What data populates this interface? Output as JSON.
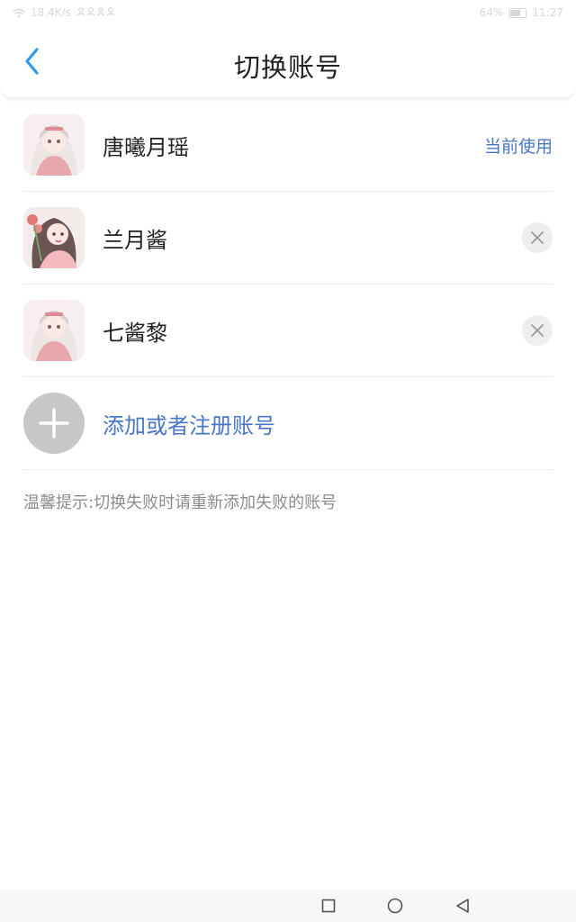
{
  "status_bar": {
    "speed": "18.4K/s",
    "battery": "64%",
    "time": "11:27"
  },
  "header": {
    "title": "切换账号",
    "back_icon": "chevron-left-icon"
  },
  "accounts": [
    {
      "name": "唐曦月瑶",
      "status": "当前使用"
    },
    {
      "name": "兰月酱"
    },
    {
      "name": "七酱黎"
    }
  ],
  "add_account": {
    "label": "添加或者注册账号",
    "icon": "plus-icon"
  },
  "tip": "温馨提示:切换失败时请重新添加失败的账号",
  "colors": {
    "accent": "#4a77c4",
    "back_arrow": "#2f9be8",
    "tip_text": "#8c8c8c",
    "add_circle": "#c7c7c7"
  }
}
